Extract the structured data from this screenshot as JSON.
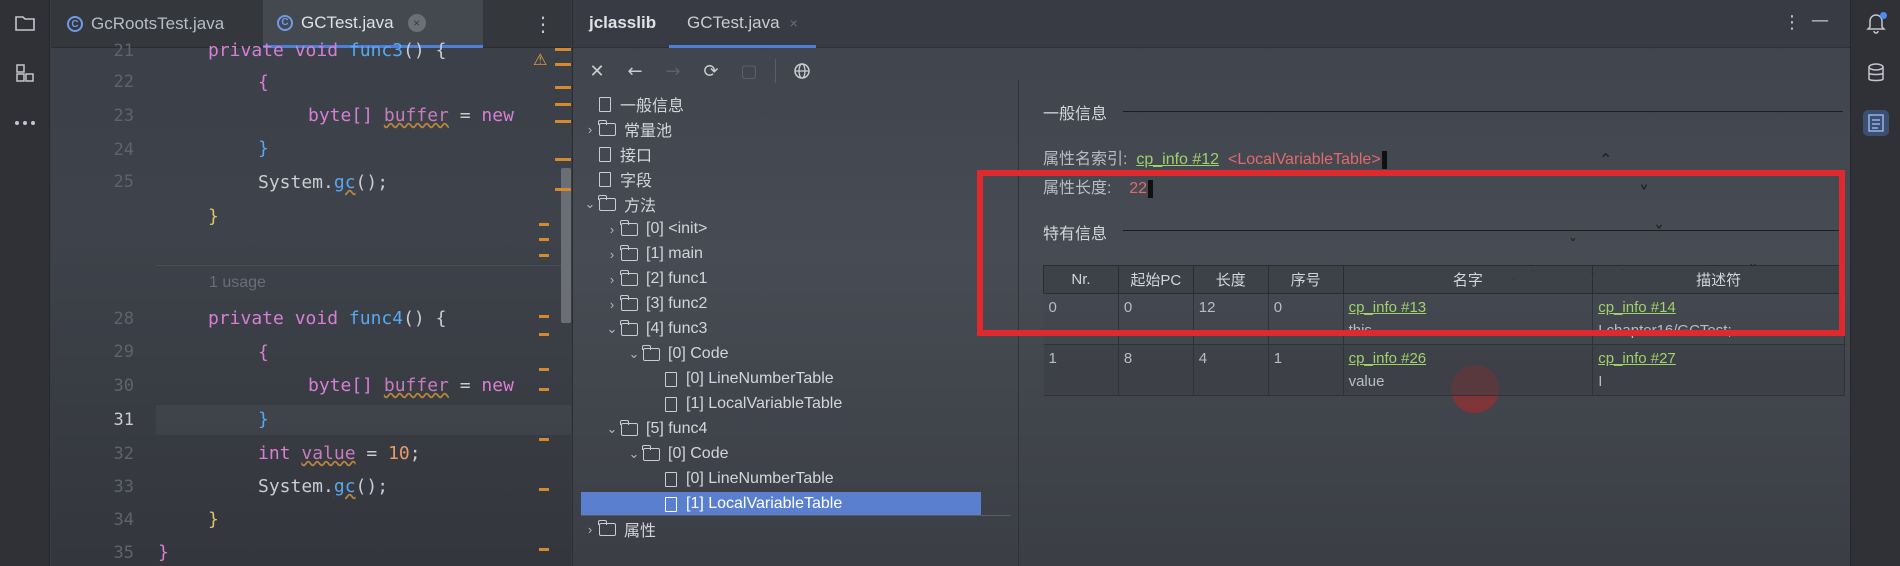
{
  "editor": {
    "tabs": [
      {
        "label": "GcRootsTest.java",
        "icon": "class-icon"
      },
      {
        "label": "GCTest.java",
        "icon": "class-icon",
        "active": true
      }
    ],
    "line_numbers": [
      "21",
      "22",
      "23",
      "24",
      "25",
      "",
      "28",
      "29",
      "30",
      "31",
      "32",
      "33",
      "34",
      "35"
    ],
    "usage_hint": "1 usage",
    "code": {
      "l21_pre": "private void ",
      "l21_fn": "func3",
      "l21_post": "() {",
      "l22": "{",
      "l23_type": "byte[] ",
      "l23_var": "buffer",
      "l23_eq": " = ",
      "l23_new": "new",
      "l24": "}",
      "l25_sys": "System.",
      "l25_gc": "gc",
      "l25_end": "();",
      "l26": "}",
      "l28_pre": "private void ",
      "l28_fn": "func4",
      "l28_post": "() {",
      "l29": "{",
      "l30_type": "byte[] ",
      "l30_var": "buffer",
      "l30_eq": " = ",
      "l30_new": "new",
      "l31": "}",
      "l32_type": "int ",
      "l32_var": "value",
      "l32_eq": " = ",
      "l32_num": "10",
      "l32_end": ";",
      "l33_sys": "System.",
      "l33_gc": "gc",
      "l33_end": "();",
      "l34": "}",
      "l35": "}"
    }
  },
  "jclasslib": {
    "title": "jclasslib",
    "tab": "GCTest.java",
    "tab_close": "×",
    "tree": [
      {
        "label": "一般信息",
        "type": "file",
        "level": 0
      },
      {
        "label": "常量池",
        "type": "folder",
        "level": 0,
        "chevron": "›"
      },
      {
        "label": "接口",
        "type": "file",
        "level": 0
      },
      {
        "label": "字段",
        "type": "file",
        "level": 0
      },
      {
        "label": "方法",
        "type": "folder",
        "level": 0,
        "chevron": "⌄"
      },
      {
        "label": "[0] <init>",
        "type": "folder",
        "level": 1,
        "chevron": "›"
      },
      {
        "label": "[1] main",
        "type": "folder",
        "level": 1,
        "chevron": "›"
      },
      {
        "label": "[2] func1",
        "type": "folder",
        "level": 1,
        "chevron": "›"
      },
      {
        "label": "[3] func2",
        "type": "folder",
        "level": 1,
        "chevron": "›"
      },
      {
        "label": "[4] func3",
        "type": "folder",
        "level": 1,
        "chevron": "⌄"
      },
      {
        "label": "[0] Code",
        "type": "folder",
        "level": 2,
        "chevron": "⌄"
      },
      {
        "label": "[0] LineNumberTable",
        "type": "file",
        "level": 3
      },
      {
        "label": "[1] LocalVariableTable",
        "type": "file",
        "level": 3
      },
      {
        "label": "[5] func4",
        "type": "folder",
        "level": 1,
        "chevron": "⌄"
      },
      {
        "label": "[0] Code",
        "type": "folder",
        "level": 2,
        "chevron": "⌄"
      },
      {
        "label": "[0] LineNumberTable",
        "type": "file",
        "level": 3
      },
      {
        "label": "[1] LocalVariableTable",
        "type": "file",
        "level": 3,
        "selected": true
      },
      {
        "label": "属性",
        "type": "folder",
        "level": 0,
        "chevron": "›"
      }
    ],
    "general": {
      "section_title": "一般信息",
      "attr_name_label": "属性名索引:",
      "attr_name_link": "cp_info #12",
      "attr_name_value": "<LocalVariableTable>",
      "attr_len_label": "属性长度:",
      "attr_len_value": "22"
    },
    "specific": {
      "section_title": "特有信息",
      "columns": [
        "Nr.",
        "起始PC",
        "长度",
        "序号",
        "名字",
        "描述符"
      ],
      "rows": [
        {
          "nr": "0",
          "start_pc": "0",
          "length": "12",
          "index": "0",
          "name_link": "cp_info #13",
          "name": "this",
          "desc_link": "cp_info #14",
          "desc": "Lchapter16/GCTest;"
        },
        {
          "nr": "1",
          "start_pc": "8",
          "length": "4",
          "index": "1",
          "name_link": "cp_info #26",
          "name": "value",
          "desc_link": "cp_info #27",
          "desc": "I"
        }
      ]
    }
  },
  "colors": {
    "highlight": "#e0292d",
    "link": "#9fd26a",
    "selection": "#5a7fcf",
    "accent": "#4e7fd8"
  }
}
